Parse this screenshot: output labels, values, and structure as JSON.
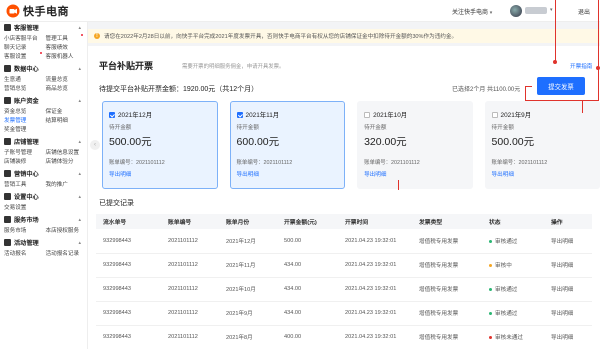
{
  "topbar": {
    "logo_text": "快手电商",
    "follow_label": "关注快手电商",
    "logout": "退出"
  },
  "sidebar": {
    "sections": [
      {
        "title": "客服管理",
        "rows": [
          [
            "小店客服平台",
            "管理工具"
          ],
          [
            "聊天记录",
            "客服绩效"
          ],
          [
            "客服设置",
            "客服机器人"
          ]
        ]
      },
      {
        "title": "数据中心",
        "rows": [
          [
            "生意通",
            "流量总览"
          ],
          [
            "营销总览",
            "商品总览"
          ]
        ]
      },
      {
        "title": "账户资金",
        "rows": [
          [
            "资金总览",
            "保证金"
          ],
          [
            "发票管理",
            "结算明细"
          ],
          [
            "奖金管理",
            ""
          ]
        ]
      },
      {
        "title": "店铺管理",
        "rows": [
          [
            "子账号管理",
            "店铺信息设置"
          ],
          [
            "店铺装修",
            "店铺体验分"
          ]
        ]
      },
      {
        "title": "营销中心",
        "rows": [
          [
            "营销工具",
            "我的推广"
          ]
        ]
      },
      {
        "title": "设置中心",
        "rows": [
          [
            "交易设置",
            ""
          ]
        ]
      },
      {
        "title": "服务市场",
        "rows": [
          [
            "服务市场",
            "本店授权服务"
          ]
        ]
      },
      {
        "title": "活动管理",
        "rows": [
          [
            "活动报名",
            "活动报名记录"
          ]
        ]
      }
    ]
  },
  "notice": {
    "text": "请您在2022年2月28日以前，向快手平台完成2021年度发票开具，否则快手电商平台有权从您的店铺保证金中扣除待开金额的30%作为违约金。"
  },
  "main": {
    "title": "平台补贴开票",
    "desc": "需要开票的明细服务佣金，申请开具发票。",
    "guide": "开票指南",
    "pending_label": "待提交平台补贴开票金额：",
    "pending_value": "1920.00元（共12个月）",
    "selected_info": "已选择2个月  共1100.00元",
    "submit": "提交发票"
  },
  "cards": [
    {
      "month": "2021年12月",
      "sub": "待开金额",
      "amount": "500.00元",
      "bill": "账单编号：2021101112",
      "link": "导出明细",
      "selected": true
    },
    {
      "month": "2021年11月",
      "sub": "待开金额",
      "amount": "600.00元",
      "bill": "账单编号：2021101112",
      "link": "导出明细",
      "selected": true
    },
    {
      "month": "2021年10月",
      "sub": "待开金额",
      "amount": "320.00元",
      "bill": "账单编号：2021101112",
      "link": "导出明细",
      "selected": false
    },
    {
      "month": "2021年9月",
      "sub": "待开金额",
      "amount": "500.00元",
      "bill": "账单编号：2021101112",
      "link": "导出明细",
      "selected": false
    }
  ],
  "records": {
    "title": "已提交记录",
    "columns": [
      "流水单号",
      "账单编号",
      "账单月份",
      "开票金额(元)",
      "开票时间",
      "发票类型",
      "状态",
      "操作"
    ],
    "rows": [
      [
        "932998443",
        "2021101112",
        "2021年12月",
        "500.00",
        "2021.04.23  19:32:01",
        "增值税专用发票",
        "审核通过",
        "导出明细"
      ],
      [
        "932998443",
        "2021101112",
        "2021年11月",
        "434.00",
        "2021.04.23  19:32:01",
        "增值税专用发票",
        "审核中",
        "导出明细"
      ],
      [
        "932998443",
        "2021101112",
        "2021年10月",
        "434.00",
        "2021.04.23  19:32:01",
        "增值税专用发票",
        "审核通过",
        "导出明细"
      ],
      [
        "932998443",
        "2021101112",
        "2021年9月",
        "434.00",
        "2021.04.23  19:32:01",
        "增值税专用发票",
        "审核通过",
        "导出明细"
      ],
      [
        "932998443",
        "2021101112",
        "2021年8月",
        "400.00",
        "2021.04.23  19:32:01",
        "增值税专用发票",
        "审核未通过",
        "导出明细"
      ]
    ],
    "status_colors": {
      "审核通过": "#2bb673",
      "审核中": "#f5a623",
      "审核未通过": "#e0332c"
    }
  },
  "colors": {
    "accent": "#1e6fff",
    "annotation": "#e0332c"
  }
}
